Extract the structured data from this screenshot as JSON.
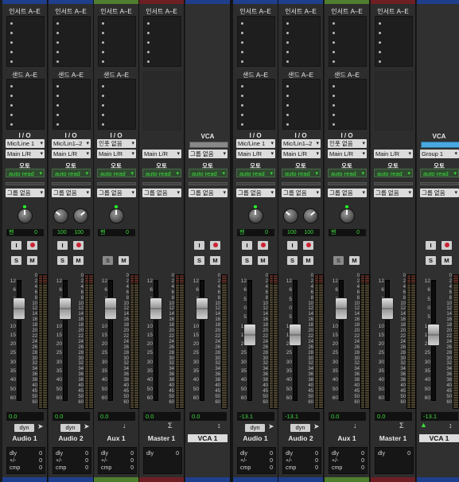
{
  "colors": {
    "blue": "#1f3f8c",
    "green": "#4f7f2e",
    "red": "#6e1f24",
    "accent_green": "#3ddc3d",
    "blue_vca": "#1f3f8c"
  },
  "labels": {
    "inserts": "인서트 A–E",
    "sends": "샌드 A–E",
    "io": "I / O",
    "auto": "오토",
    "vca": "VCA"
  },
  "strips": [
    {
      "kind": "audio",
      "name": "Audio 1",
      "color": "blue",
      "input": "Mic/Line 1",
      "output": "Main L/R",
      "auto": "auto read",
      "group": "그룹 없음",
      "pan": "mono",
      "pan_label": "팬",
      "pan_value": "0",
      "vol": "0.0",
      "dyn": "dyn",
      "dly": "0",
      "pm": "0",
      "cmp": "0",
      "record": true
    },
    {
      "kind": "audio",
      "name": "Audio 2",
      "color": "blue",
      "input": "Mic/Lin1–2",
      "output": "Main L/R",
      "auto": "auto read",
      "group": "그룹 없음",
      "pan": "stereo",
      "pan_l": "100",
      "pan_r": "100",
      "vol": "0.0",
      "dyn": "dyn",
      "dly": "0",
      "pm": "0",
      "cmp": "0",
      "record": true
    },
    {
      "kind": "aux",
      "name": "Aux 1",
      "color": "green",
      "input": "인풋 없음",
      "output": "Main L/R",
      "auto": "auto read",
      "group": "그룹 없음",
      "pan": "mono",
      "pan_label": "팬",
      "pan_value": "0",
      "vol": "0.0",
      "dly": "0",
      "pm": "0",
      "cmp": "0",
      "record": false
    },
    {
      "kind": "master",
      "name": "Master 1",
      "color": "red",
      "output": "Main L/R",
      "auto": "auto read",
      "group": "그룹 없음",
      "vol": "0.0",
      "dly": "0"
    },
    {
      "kind": "vca",
      "name": "VCA 1",
      "color": "blue",
      "group_assign": "그룹 없음",
      "auto": "auto read",
      "group": "그룹 없음",
      "vol": "0.0"
    },
    {
      "kind": "audio",
      "name": "Audio 1",
      "color": "blue",
      "input": "Mic/Line 1",
      "output": "Main L/R",
      "auto": "auto read",
      "group": "그룹 없음",
      "pan": "mono",
      "pan_label": "팬",
      "pan_value": "0",
      "vol": "-13.1",
      "dyn": "dyn",
      "dly": "0",
      "pm": "0",
      "cmp": "0",
      "record": true
    },
    {
      "kind": "audio",
      "name": "Audio 2",
      "color": "blue",
      "input": "Mic/Lin1–2",
      "output": "Main L/R",
      "auto": "auto read",
      "group": "그룹 없음",
      "pan": "stereo",
      "pan_l": "100",
      "pan_r": "100",
      "vol": "-13.1",
      "dyn": "dyn",
      "dly": "0",
      "pm": "0",
      "cmp": "0",
      "record": true
    },
    {
      "kind": "aux",
      "name": "Aux 1",
      "color": "green",
      "input": "인풋 없음",
      "output": "Main L/R",
      "auto": "auto read",
      "group": "그룹 없음",
      "pan": "mono",
      "pan_label": "팬",
      "pan_value": "0",
      "vol": "0.0",
      "dly": "0",
      "pm": "0",
      "cmp": "0",
      "record": false
    },
    {
      "kind": "master",
      "name": "Master 1",
      "color": "red",
      "output": "Main L/R",
      "auto": "auto read",
      "group": "그룹 없음",
      "vol": "0.0",
      "dly": "0"
    },
    {
      "kind": "vca",
      "name": "VCA 1",
      "color": "blue",
      "group_assign": "Group 1",
      "auto": "auto read",
      "group": "그룹 없음",
      "vol": "-13.1",
      "selected": true
    }
  ],
  "scale_ticks": [
    "12",
    "6",
    "5",
    "0",
    "5",
    "10",
    "15",
    "20",
    "25",
    "30",
    "35",
    "40",
    "50",
    "60"
  ],
  "meter_ticks": [
    "0",
    "2",
    "4",
    "6",
    "8",
    "10",
    "12",
    "14",
    "16",
    "18",
    "20",
    "22",
    "24",
    "26",
    "28",
    "30",
    "32",
    "34",
    "36",
    "38",
    "40",
    "45",
    "50",
    "60"
  ]
}
